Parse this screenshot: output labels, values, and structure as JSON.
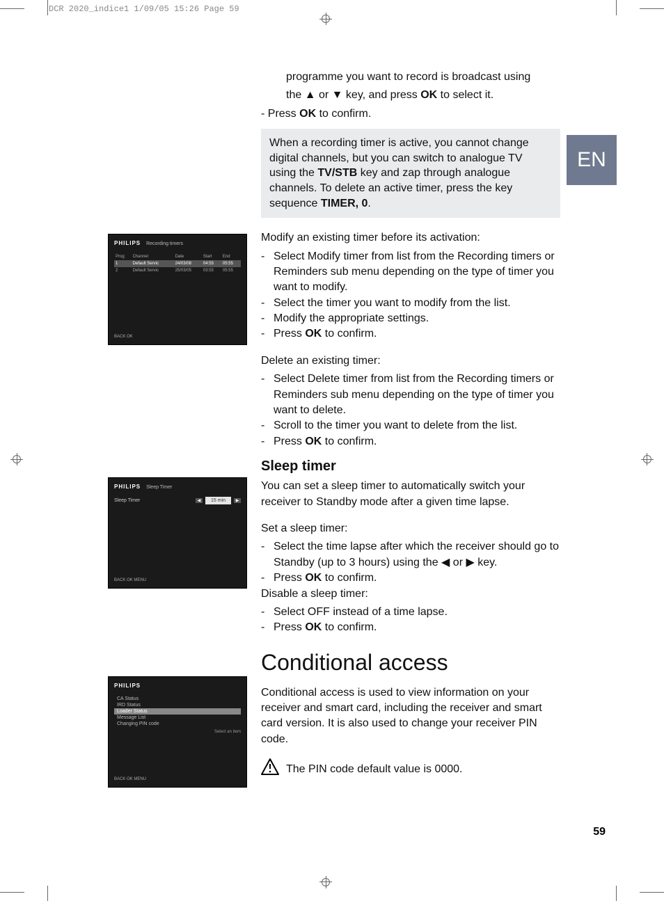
{
  "header_strip": "DCR 2020_indice1  1/09/05  15:26  Page 59",
  "lang_tab": "EN",
  "page_number": "59",
  "intro": {
    "line1a": "programme you want to record is broadcast using",
    "line1b": "the ▲ or ▼ key, and press ",
    "line1c_bold": "OK",
    "line1d": " to select it.",
    "confirm_dash": "-  Press ",
    "confirm_bold": "OK",
    "confirm_tail": " to confirm."
  },
  "note": {
    "l1": "When a recording timer is active, you cannot change digital channels, but you can switch to analogue TV using the ",
    "l1b": "TV/STB",
    "l1c": " key and zap through analogue channels. To delete an active timer, press the key sequence ",
    "l1d": "TIMER, 0",
    "l1e": "."
  },
  "modify": {
    "title": "Modify an existing timer before its activation:",
    "b1": "Select Modify timer from list from the Recording timers or Reminders sub menu depending on the type of timer you want to modify.",
    "b2": "Select the timer you want to modify from the list.",
    "b3": "Modify the appropriate settings.",
    "b4a": "Press ",
    "b4b": "OK",
    "b4c": " to confirm."
  },
  "delete": {
    "title": "Delete an existing timer:",
    "b1": "Select Delete timer from list from the Recording timers or Reminders sub menu depending on the type of timer you want to delete.",
    "b2": "Scroll to the timer you want to delete from the list.",
    "b3a": "Press ",
    "b3b": "OK",
    "b3c": " to confirm."
  },
  "sleep": {
    "heading": "Sleep timer",
    "p1": "You can set a sleep timer to automatically switch your receiver to Standby mode after a given time lapse.",
    "set_title": "Set a sleep timer:",
    "s1": "Select the time lapse after which the receiver should go to Standby (up to 3 hours) using the ◀ or ▶  key.",
    "s2a": "Press ",
    "s2b": "OK",
    "s2c": " to confirm.",
    "dis_title": "Disable a sleep timer:",
    "d1": "Select OFF instead of a time lapse.",
    "d2a": "Press ",
    "d2b": "OK",
    "d2c": " to confirm."
  },
  "cond": {
    "heading": "Conditional access",
    "p1": "Conditional access is used to view information on your receiver and smart card, including the receiver and smart card version. It is also used to change your receiver PIN code.",
    "warn": "The PIN code default value is 0000."
  },
  "thumb1": {
    "brand": "PHILIPS",
    "title": "Recording timers",
    "columns": [
      "Prog",
      "Channel",
      "Date",
      "Start",
      "End"
    ],
    "rows": [
      {
        "prog": "1",
        "channel": "Default Servic",
        "date": "24/03/08",
        "start": "04:55",
        "end": "05:55"
      },
      {
        "prog": "2",
        "channel": "Default Servic",
        "date": "25/03/05",
        "start": "03:55",
        "end": "05:55"
      }
    ],
    "footer": "BACK    OK"
  },
  "thumb2": {
    "brand": "PHILIPS",
    "title": "Sleep Timer",
    "row_label": "Sleep Timer",
    "row_value": "15 min",
    "footer": "BACK    OK    MENU"
  },
  "thumb3": {
    "brand": "PHILIPS",
    "items": [
      "CA Status",
      "IRD Status",
      "Loader Status",
      "Message List",
      "Changing PIN code"
    ],
    "selected_index": 2,
    "hint": "Select an item",
    "footer": "BACK    OK    MENU"
  }
}
